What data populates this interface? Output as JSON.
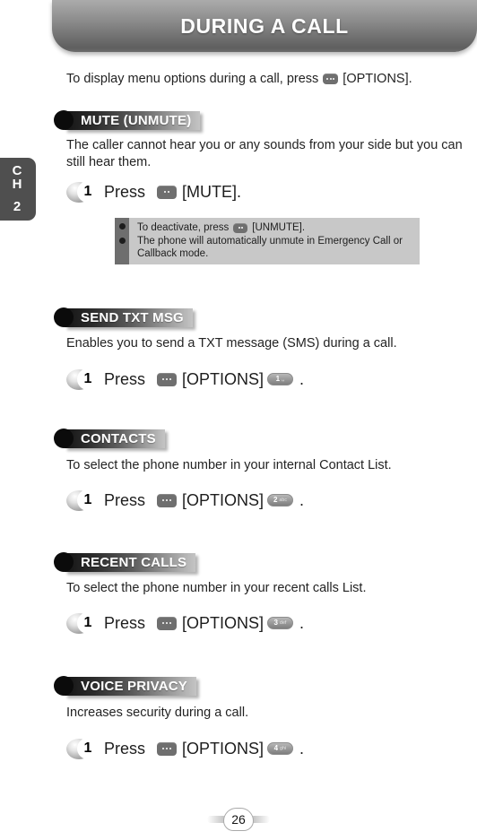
{
  "page": {
    "title": "DURING A CALL",
    "chapter_letters": "CH",
    "chapter_letter_1": "C",
    "chapter_letter_2": "H",
    "chapter_number": "2",
    "page_number": "26"
  },
  "intro": {
    "before": "To display menu options during a call, press",
    "key_icon": "softkey-options-icon",
    "after": "[OPTIONS]."
  },
  "sections": [
    {
      "id": "mute",
      "header": "MUTE (UNMUTE)",
      "body": "The caller cannot hear you or any sounds from your side but you can still hear them.",
      "step": {
        "number": "1",
        "verb": "Press",
        "key_icon": "softkey-options-icon",
        "label": "[MUTE].",
        "numkey": null
      },
      "note": {
        "lines": [
          {
            "before": "To deactivate, press",
            "key_icon": "softkey-options-icon",
            "after": "[UNMUTE]."
          },
          {
            "before": "The phone will automatically unmute in Emergency Call or Callback mode.",
            "key_icon": null,
            "after": ""
          }
        ]
      }
    },
    {
      "id": "send-txt-msg",
      "header": "SEND TXT MSG",
      "body": "Enables you to send a TXT message (SMS) during a call.",
      "step": {
        "number": "1",
        "verb": "Press",
        "key_icon": "softkey-options-icon",
        "label": "[OPTIONS]",
        "numkey": {
          "digit": "1",
          "letters": "␣"
        },
        "period": "."
      }
    },
    {
      "id": "contacts",
      "header": "CONTACTS",
      "body": "To select the phone number in your internal Contact List.",
      "step": {
        "number": "1",
        "verb": "Press",
        "key_icon": "softkey-options-icon",
        "label": "[OPTIONS]",
        "numkey": {
          "digit": "2",
          "letters": "abc"
        },
        "period": "."
      }
    },
    {
      "id": "recent-calls",
      "header": "RECENT CALLS",
      "body": "To select the phone number in your recent calls List.",
      "step": {
        "number": "1",
        "verb": "Press",
        "key_icon": "softkey-options-icon",
        "label": "[OPTIONS]",
        "numkey": {
          "digit": "3",
          "letters": "def"
        },
        "period": "."
      }
    },
    {
      "id": "voice-privacy",
      "header": "VOICE PRIVACY",
      "body": "Increases security during a call.",
      "step": {
        "number": "1",
        "verb": "Press",
        "key_icon": "softkey-options-icon",
        "label": "[OPTIONS]",
        "numkey": {
          "digit": "4",
          "letters": "ghi"
        },
        "period": "."
      }
    }
  ],
  "colors": {
    "title_bar_dark": "#5f5f5f",
    "title_bar_light": "#ababab",
    "header_bar_dark": "#141414",
    "header_bar_light": "#c4c4c4",
    "chapter_tab": "#4f4f4f",
    "note_rail": "#6e6e6e",
    "note_body": "#c8c8c8",
    "softkey": "#6f6f6f"
  }
}
